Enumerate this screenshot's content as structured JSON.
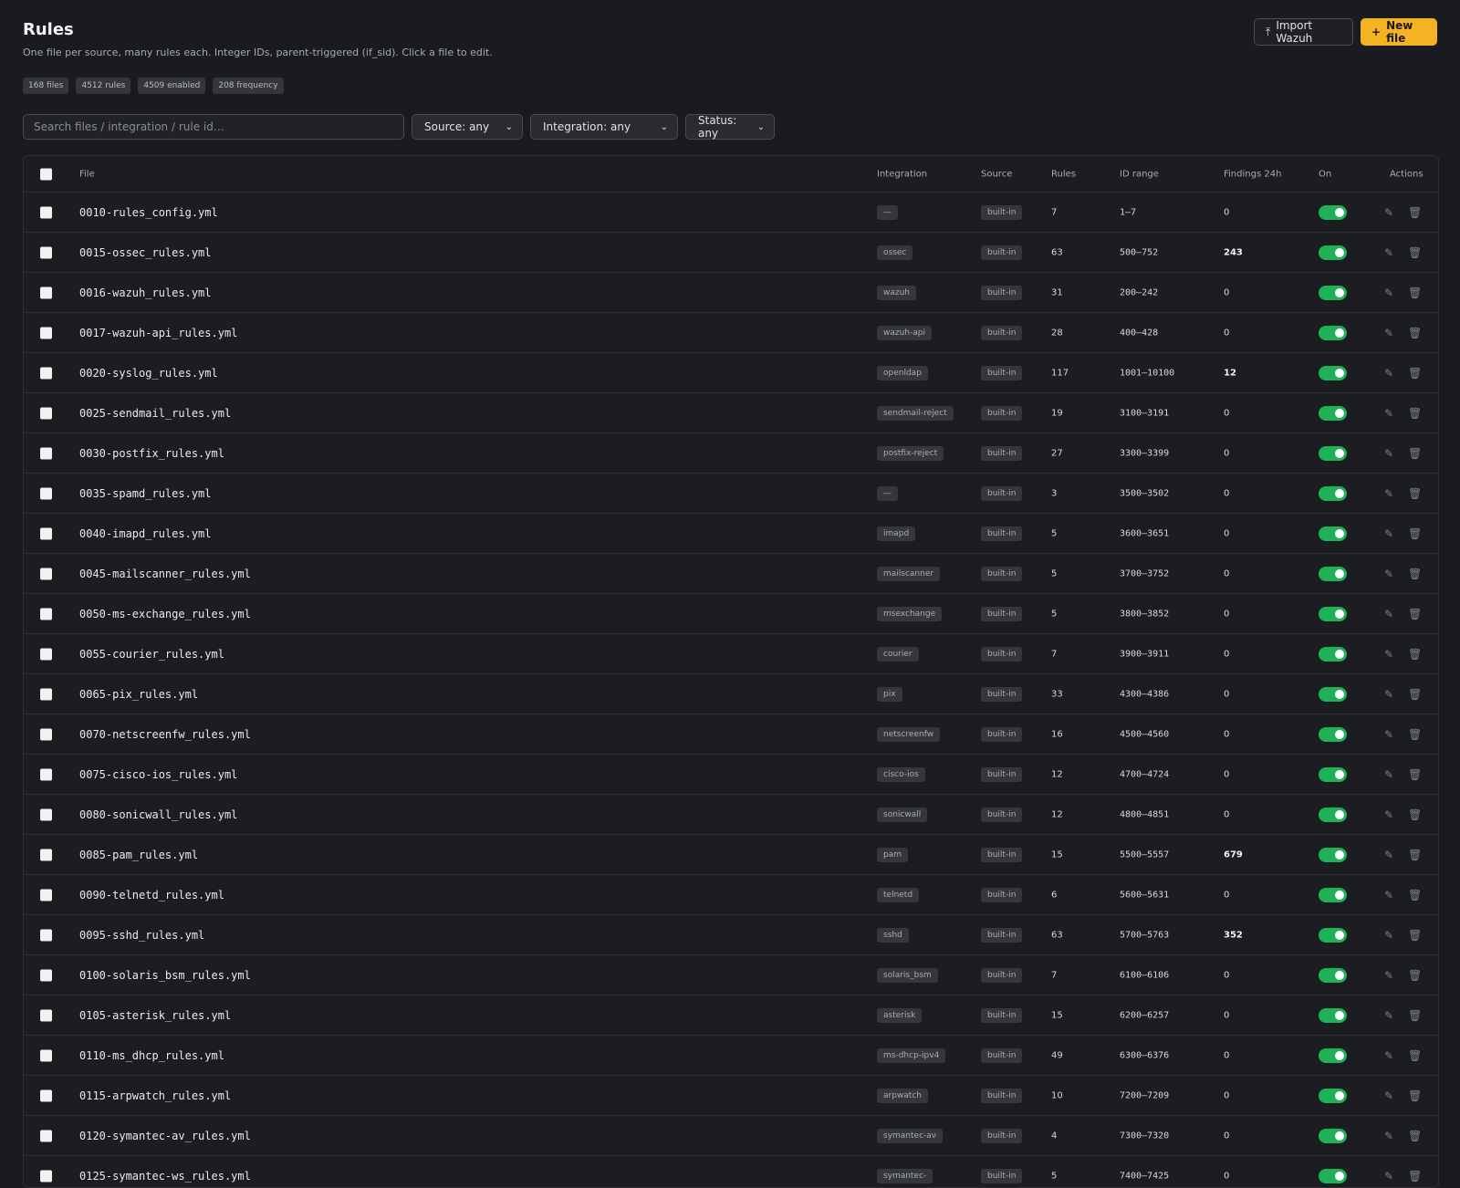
{
  "header": {
    "title": "Rules",
    "subtitle": "One file per source, many rules each. Integer IDs, parent-triggered (if_sid). Click a file to edit.",
    "import_label": "Import Wazuh",
    "new_file_label": "New file"
  },
  "stats": [
    "168 files",
    "4512 rules",
    "4509 enabled",
    "208 frequency"
  ],
  "filters": {
    "search_placeholder": "Search files / integration / rule id…",
    "source": "Source: any",
    "integration": "Integration: any",
    "status": "Status: any"
  },
  "columns": {
    "file": "File",
    "integration": "Integration",
    "source": "Source",
    "rules": "Rules",
    "id_range": "ID range",
    "findings": "Findings 24h",
    "on": "On",
    "actions": "Actions"
  },
  "icons": {
    "import": "upload-icon",
    "new": "plus-icon",
    "edit": "pencil-icon",
    "delete": "trash-icon"
  },
  "colors": {
    "accent": "#f5b324",
    "toggle_on": "#1fb156",
    "background": "#1a1b1e"
  },
  "rows": [
    {
      "file": "0010-rules_config.yml",
      "integration": "—",
      "source": "built-in",
      "rules": "7",
      "range": "1–7",
      "findings": "0",
      "on": true
    },
    {
      "file": "0015-ossec_rules.yml",
      "integration": "ossec",
      "source": "built-in",
      "rules": "63",
      "range": "500–752",
      "findings": "243",
      "on": true
    },
    {
      "file": "0016-wazuh_rules.yml",
      "integration": "wazuh",
      "source": "built-in",
      "rules": "31",
      "range": "200–242",
      "findings": "0",
      "on": true
    },
    {
      "file": "0017-wazuh-api_rules.yml",
      "integration": "wazuh-api",
      "source": "built-in",
      "rules": "28",
      "range": "400–428",
      "findings": "0",
      "on": true
    },
    {
      "file": "0020-syslog_rules.yml",
      "integration": "openldap",
      "source": "built-in",
      "rules": "117",
      "range": "1001–10100",
      "findings": "12",
      "on": true
    },
    {
      "file": "0025-sendmail_rules.yml",
      "integration": "sendmail-reject",
      "source": "built-in",
      "rules": "19",
      "range": "3100–3191",
      "findings": "0",
      "on": true
    },
    {
      "file": "0030-postfix_rules.yml",
      "integration": "postfix-reject",
      "source": "built-in",
      "rules": "27",
      "range": "3300–3399",
      "findings": "0",
      "on": true
    },
    {
      "file": "0035-spamd_rules.yml",
      "integration": "—",
      "source": "built-in",
      "rules": "3",
      "range": "3500–3502",
      "findings": "0",
      "on": true
    },
    {
      "file": "0040-imapd_rules.yml",
      "integration": "imapd",
      "source": "built-in",
      "rules": "5",
      "range": "3600–3651",
      "findings": "0",
      "on": true
    },
    {
      "file": "0045-mailscanner_rules.yml",
      "integration": "mailscanner",
      "source": "built-in",
      "rules": "5",
      "range": "3700–3752",
      "findings": "0",
      "on": true
    },
    {
      "file": "0050-ms-exchange_rules.yml",
      "integration": "msexchange",
      "source": "built-in",
      "rules": "5",
      "range": "3800–3852",
      "findings": "0",
      "on": true
    },
    {
      "file": "0055-courier_rules.yml",
      "integration": "courier",
      "source": "built-in",
      "rules": "7",
      "range": "3900–3911",
      "findings": "0",
      "on": true
    },
    {
      "file": "0065-pix_rules.yml",
      "integration": "pix",
      "source": "built-in",
      "rules": "33",
      "range": "4300–4386",
      "findings": "0",
      "on": true
    },
    {
      "file": "0070-netscreenfw_rules.yml",
      "integration": "netscreenfw",
      "source": "built-in",
      "rules": "16",
      "range": "4500–4560",
      "findings": "0",
      "on": true
    },
    {
      "file": "0075-cisco-ios_rules.yml",
      "integration": "cisco-ios",
      "source": "built-in",
      "rules": "12",
      "range": "4700–4724",
      "findings": "0",
      "on": true
    },
    {
      "file": "0080-sonicwall_rules.yml",
      "integration": "sonicwall",
      "source": "built-in",
      "rules": "12",
      "range": "4800–4851",
      "findings": "0",
      "on": true
    },
    {
      "file": "0085-pam_rules.yml",
      "integration": "pam",
      "source": "built-in",
      "rules": "15",
      "range": "5500–5557",
      "findings": "679",
      "on": true
    },
    {
      "file": "0090-telnetd_rules.yml",
      "integration": "telnetd",
      "source": "built-in",
      "rules": "6",
      "range": "5600–5631",
      "findings": "0",
      "on": true
    },
    {
      "file": "0095-sshd_rules.yml",
      "integration": "sshd",
      "source": "built-in",
      "rules": "63",
      "range": "5700–5763",
      "findings": "352",
      "on": true
    },
    {
      "file": "0100-solaris_bsm_rules.yml",
      "integration": "solaris_bsm",
      "source": "built-in",
      "rules": "7",
      "range": "6100–6106",
      "findings": "0",
      "on": true
    },
    {
      "file": "0105-asterisk_rules.yml",
      "integration": "asterisk",
      "source": "built-in",
      "rules": "15",
      "range": "6200–6257",
      "findings": "0",
      "on": true
    },
    {
      "file": "0110-ms_dhcp_rules.yml",
      "integration": "ms-dhcp-ipv4",
      "source": "built-in",
      "rules": "49",
      "range": "6300–6376",
      "findings": "0",
      "on": true
    },
    {
      "file": "0115-arpwatch_rules.yml",
      "integration": "arpwatch",
      "source": "built-in",
      "rules": "10",
      "range": "7200–7209",
      "findings": "0",
      "on": true
    },
    {
      "file": "0120-symantec-av_rules.yml",
      "integration": "symantec-av",
      "source": "built-in",
      "rules": "4",
      "range": "7300–7320",
      "findings": "0",
      "on": true
    },
    {
      "file": "0125-symantec-ws_rules.yml",
      "integration": "symantec-",
      "source": "built-in",
      "rules": "5",
      "range": "7400–7425",
      "findings": "0",
      "on": true
    }
  ]
}
